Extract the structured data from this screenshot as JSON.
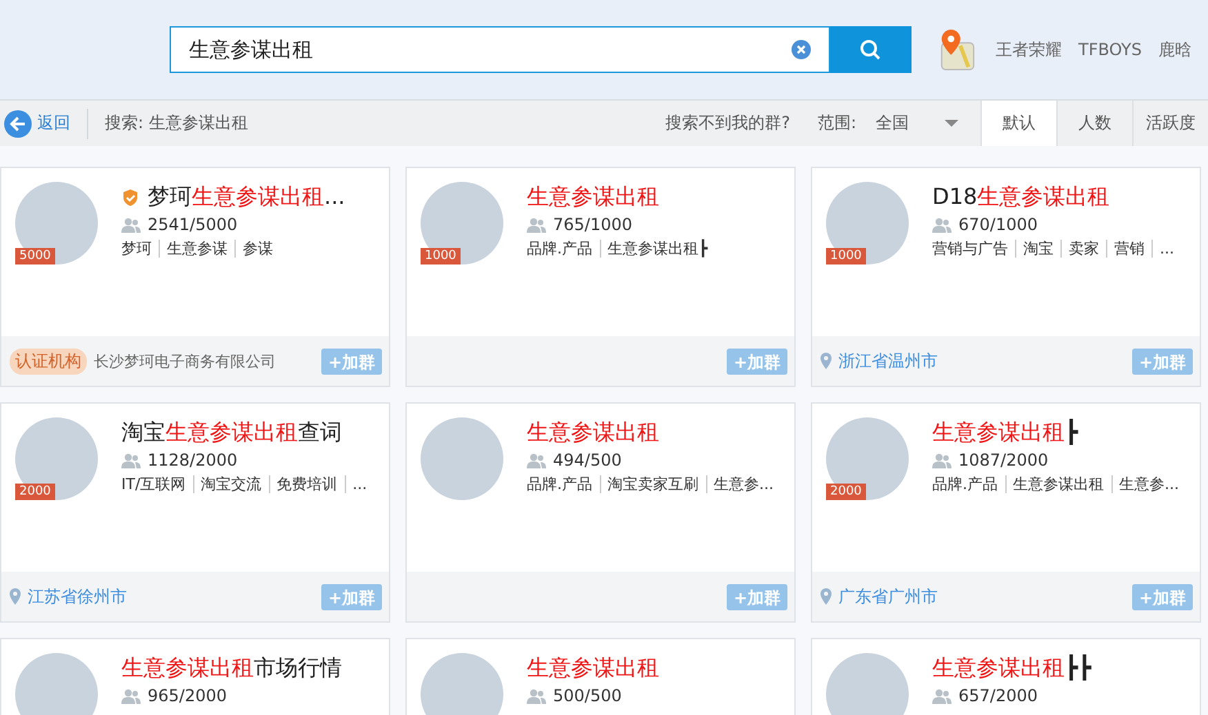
{
  "search": {
    "value": "生意参谋出租"
  },
  "top_links": [
    "王者荣耀",
    "TFBOYS",
    "鹿晗"
  ],
  "toolbar": {
    "back": "返回",
    "query": "搜索: 生意参谋出租",
    "help_link": "搜索不到我的群?",
    "range_label": "范围:",
    "range_value": "全国",
    "sort_tabs": [
      {
        "label": "默认",
        "selected": true
      },
      {
        "label": "人数",
        "selected": false
      },
      {
        "label": "活跃度",
        "selected": false
      }
    ]
  },
  "cards": [
    {
      "verified": true,
      "title": [
        {
          "text": "梦珂",
          "highlight": false
        },
        {
          "text": "生意参谋出租",
          "highlight": true
        },
        {
          "text": "...",
          "highlight": false
        }
      ],
      "members": "2541/5000",
      "badge": "5000",
      "tags": [
        "梦珂",
        "生意参谋",
        "参谋"
      ],
      "footer": {
        "kind": "org",
        "tag": "认证机构",
        "text": "长沙梦珂电子商务有限公司"
      },
      "join": "+加群"
    },
    {
      "verified": false,
      "title": [
        {
          "text": "生意参谋出租",
          "highlight": true
        }
      ],
      "members": "765/1000",
      "badge": "1000",
      "tags": [
        "品牌.产品",
        "生意参谋出租┣"
      ],
      "footer": {
        "kind": "none"
      },
      "join": "+加群"
    },
    {
      "verified": false,
      "title": [
        {
          "text": "D18",
          "highlight": false
        },
        {
          "text": "生意参谋出租",
          "highlight": true
        }
      ],
      "members": "670/1000",
      "badge": "1000",
      "tags": [
        "营销与广告",
        "淘宝",
        "卖家",
        "营销",
        "..."
      ],
      "footer": {
        "kind": "location",
        "text": "浙江省温州市"
      },
      "join": "+加群"
    },
    {
      "verified": false,
      "title": [
        {
          "text": "淘宝",
          "highlight": false
        },
        {
          "text": "生意参谋出租",
          "highlight": true
        },
        {
          "text": "查词",
          "highlight": false
        }
      ],
      "members": "1128/2000",
      "badge": "2000",
      "tags": [
        "IT/互联网",
        "淘宝交流",
        "免费培训",
        "..."
      ],
      "footer": {
        "kind": "location",
        "text": "江苏省徐州市"
      },
      "join": "+加群"
    },
    {
      "verified": false,
      "title": [
        {
          "text": "生意参谋出租",
          "highlight": true
        }
      ],
      "members": "494/500",
      "tags": [
        "品牌.产品",
        "淘宝卖家互刷",
        "生意参..."
      ],
      "footer": {
        "kind": "none"
      },
      "join": "+加群"
    },
    {
      "verified": false,
      "title": [
        {
          "text": "生意参谋出租",
          "highlight": true
        },
        {
          "text": "┣",
          "highlight": false
        }
      ],
      "members": "1087/2000",
      "badge": "2000",
      "tags": [
        "品牌.产品",
        "生意参谋出租",
        "生意参..."
      ],
      "footer": {
        "kind": "location",
        "text": "广东省广州市"
      },
      "join": "+加群"
    },
    {
      "verified": false,
      "title": [
        {
          "text": "生意参谋出租",
          "highlight": true
        },
        {
          "text": "市场行情",
          "highlight": false
        }
      ],
      "members": "965/2000",
      "footer": {
        "kind": "none"
      }
    },
    {
      "verified": false,
      "title": [
        {
          "text": "生意参谋出租",
          "highlight": true
        }
      ],
      "members": "500/500",
      "footer": {
        "kind": "none"
      }
    },
    {
      "verified": false,
      "title": [
        {
          "text": "生意参谋出租",
          "highlight": true
        },
        {
          "text": "┣┣",
          "highlight": false
        }
      ],
      "members": "657/2000",
      "footer": {
        "kind": "none"
      }
    }
  ]
}
